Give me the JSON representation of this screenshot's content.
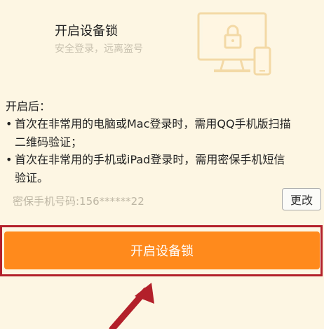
{
  "header": {
    "title": "开启设备锁",
    "subtitle": "安全登录，远离盗号"
  },
  "details": {
    "after_label": "开启后：",
    "bullets": [
      {
        "line1": "首次在非常用的电脑或Mac登录时，需用QQ手机版扫描",
        "line2": "二维码验证；"
      },
      {
        "line1": "首次在非常用的手机或iPad登录时，需用密保手机短信",
        "line2": "验证。"
      }
    ],
    "bullet_symbol": "•"
  },
  "phone": {
    "label_with_number": "密保手机号码:156******22",
    "change_label": "更改"
  },
  "action": {
    "enable_label": "开启设备锁"
  },
  "colors": {
    "background": "#fdf6e3",
    "accent_orange": "#ff8a1c",
    "highlight_red": "#b3202a",
    "illustration": "#f3d9a6"
  },
  "icons": [
    "computer-lock-icon",
    "phone-icon",
    "annotation-arrow-icon"
  ]
}
